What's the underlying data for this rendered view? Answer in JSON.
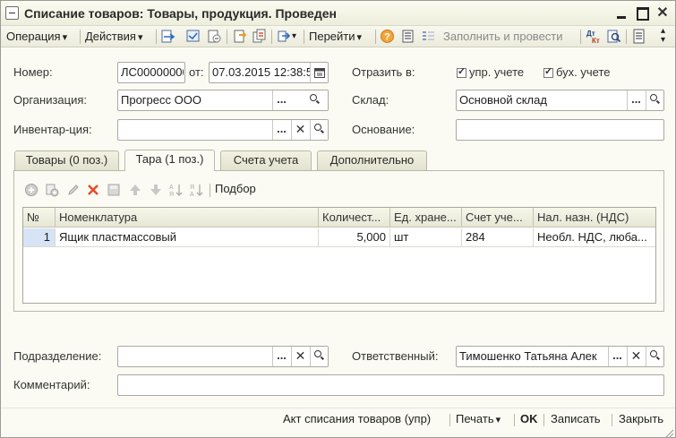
{
  "window": {
    "title": "Списание товаров: Товары, продукция. Проведен",
    "controls": {
      "minimize": "minimize",
      "maximize": "maximize",
      "close": "✕"
    }
  },
  "toolbar": {
    "operation_label": "Операция",
    "actions_label": "Действия",
    "goto_label": "Перейти",
    "fill_and_post_label": "Заполнить и провести"
  },
  "form": {
    "number_label": "Номер:",
    "number_value": "ЛС00000000",
    "date_label": "от:",
    "date_value": "07.03.2015 12:38:5",
    "reflect_label": "Отразить в:",
    "mgmt_accounting_label": "упр. учете",
    "mgmt_accounting_checked": true,
    "fin_accounting_label": "бух. учете",
    "fin_accounting_checked": true,
    "organization_label": "Организация:",
    "organization_value": "Прогресс ООО",
    "warehouse_label": "Склад:",
    "warehouse_value": "Основной склад",
    "inventory_label": "Инвентар-ция:",
    "inventory_value": "",
    "basis_label": "Основание:",
    "basis_value": "",
    "department_label": "Подразделение:",
    "department_value": "",
    "responsible_label": "Ответственный:",
    "responsible_value": "Тимошенко Татьяна Алек",
    "comment_label": "Комментарий:",
    "comment_value": ""
  },
  "tabs": [
    {
      "label": "Товары (0 поз.)",
      "active": false
    },
    {
      "label": "Тара (1 поз.)",
      "active": true
    },
    {
      "label": "Счета учета",
      "active": false
    },
    {
      "label": "Дополнительно",
      "active": false
    }
  ],
  "tab_toolbar": {
    "select_label": "Подбор"
  },
  "table": {
    "columns": [
      "№",
      "Номенклатура",
      "Количест...",
      "Ед. хране...",
      "Счет уче...",
      "Нал. назн. (НДС)"
    ],
    "rows": [
      [
        "1",
        "Ящик пластмассовый",
        "5,000",
        "шт",
        "284",
        "Необл. НДС, люба..."
      ]
    ]
  },
  "bottom_bar": {
    "act_label": "Акт списания товаров (упр)",
    "print_label": "Печать",
    "ok_label": "OK",
    "save_label": "Записать",
    "close_label": "Закрыть"
  },
  "colors": {
    "window_bg": "#fbfbf4",
    "selected_cell": "#d6e4f5",
    "disabled_text": "#8a8a8a"
  }
}
